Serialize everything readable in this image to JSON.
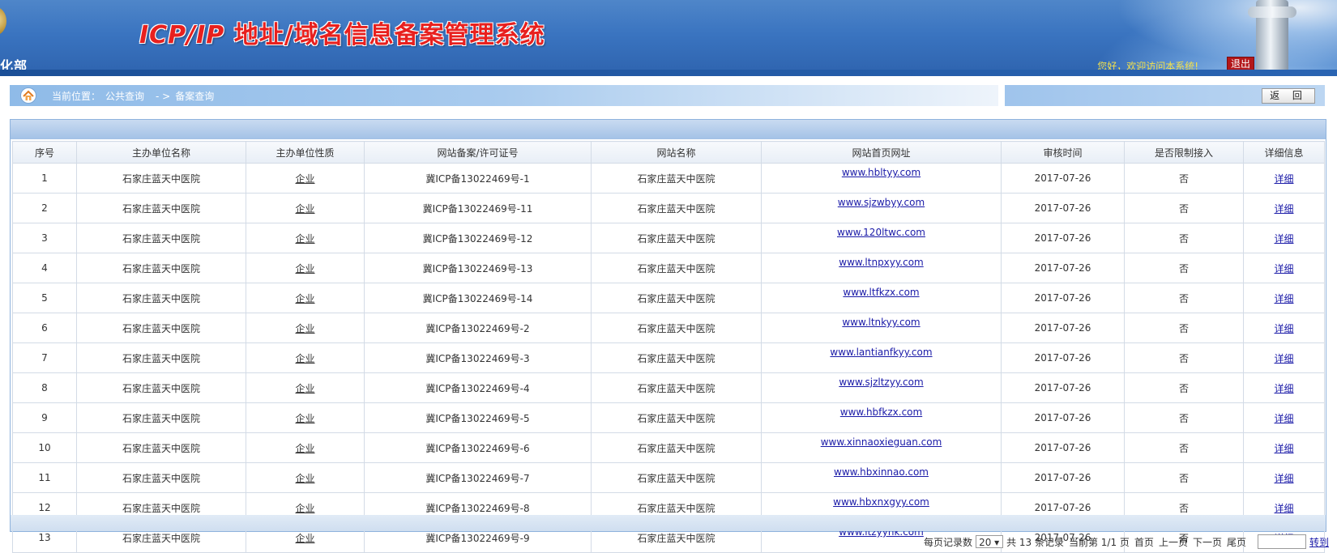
{
  "header": {
    "title_latin": "ICP/IP ",
    "title_cn": "地址/域名信息备案管理系统",
    "dept": "化部",
    "welcome": "您好，欢迎访问本系统!",
    "logout": "退出"
  },
  "breadcrumb": {
    "prefix": "当前位置：",
    "level1": "公共查询",
    "separator": "- >",
    "level2": "备案查询"
  },
  "return_button": "返 回",
  "table": {
    "headers": [
      "序号",
      "主办单位名称",
      "主办单位性质",
      "网站备案/许可证号",
      "网站名称",
      "网站首页网址",
      "审核时间",
      "是否限制接入",
      "详细信息"
    ],
    "rows": [
      {
        "no": "1",
        "org": "石家庄蓝天中医院",
        "type": "企业",
        "license": "冀ICP备13022469号-1",
        "site": "石家庄蓝天中医院",
        "url": "www.hbltyy.com",
        "date": "2017-07-26",
        "restricted": "否",
        "detail": "详细"
      },
      {
        "no": "2",
        "org": "石家庄蓝天中医院",
        "type": "企业",
        "license": "冀ICP备13022469号-11",
        "site": "石家庄蓝天中医院",
        "url": "www.sjzwbyy.com",
        "date": "2017-07-26",
        "restricted": "否",
        "detail": "详细"
      },
      {
        "no": "3",
        "org": "石家庄蓝天中医院",
        "type": "企业",
        "license": "冀ICP备13022469号-12",
        "site": "石家庄蓝天中医院",
        "url": "www.120ltwc.com",
        "date": "2017-07-26",
        "restricted": "否",
        "detail": "详细"
      },
      {
        "no": "4",
        "org": "石家庄蓝天中医院",
        "type": "企业",
        "license": "冀ICP备13022469号-13",
        "site": "石家庄蓝天中医院",
        "url": "www.ltnpxyy.com",
        "date": "2017-07-26",
        "restricted": "否",
        "detail": "详细"
      },
      {
        "no": "5",
        "org": "石家庄蓝天中医院",
        "type": "企业",
        "license": "冀ICP备13022469号-14",
        "site": "石家庄蓝天中医院",
        "url": "www.ltfkzx.com",
        "date": "2017-07-26",
        "restricted": "否",
        "detail": "详细"
      },
      {
        "no": "6",
        "org": "石家庄蓝天中医院",
        "type": "企业",
        "license": "冀ICP备13022469号-2",
        "site": "石家庄蓝天中医院",
        "url": "www.ltnkyy.com",
        "date": "2017-07-26",
        "restricted": "否",
        "detail": "详细"
      },
      {
        "no": "7",
        "org": "石家庄蓝天中医院",
        "type": "企业",
        "license": "冀ICP备13022469号-3",
        "site": "石家庄蓝天中医院",
        "url": "www.lantianfkyy.com",
        "date": "2017-07-26",
        "restricted": "否",
        "detail": "详细"
      },
      {
        "no": "8",
        "org": "石家庄蓝天中医院",
        "type": "企业",
        "license": "冀ICP备13022469号-4",
        "site": "石家庄蓝天中医院",
        "url": "www.sjzltzyy.com",
        "date": "2017-07-26",
        "restricted": "否",
        "detail": "详细"
      },
      {
        "no": "9",
        "org": "石家庄蓝天中医院",
        "type": "企业",
        "license": "冀ICP备13022469号-5",
        "site": "石家庄蓝天中医院",
        "url": "www.hbfkzx.com",
        "date": "2017-07-26",
        "restricted": "否",
        "detail": "详细"
      },
      {
        "no": "10",
        "org": "石家庄蓝天中医院",
        "type": "企业",
        "license": "冀ICP备13022469号-6",
        "site": "石家庄蓝天中医院",
        "url": "www.xinnaoxieguan.com",
        "date": "2017-07-26",
        "restricted": "否",
        "detail": "详细"
      },
      {
        "no": "11",
        "org": "石家庄蓝天中医院",
        "type": "企业",
        "license": "冀ICP备13022469号-7",
        "site": "石家庄蓝天中医院",
        "url": "www.hbxinnao.com",
        "date": "2017-07-26",
        "restricted": "否",
        "detail": "详细"
      },
      {
        "no": "12",
        "org": "石家庄蓝天中医院",
        "type": "企业",
        "license": "冀ICP备13022469号-8",
        "site": "石家庄蓝天中医院",
        "url": "www.hbxnxgyy.com",
        "date": "2017-07-26",
        "restricted": "否",
        "detail": "详细"
      },
      {
        "no": "13",
        "org": "石家庄蓝天中医院",
        "type": "企业",
        "license": "冀ICP备13022469号-9",
        "site": "石家庄蓝天中医院",
        "url": "www.ltzyynk.com",
        "date": "2017-07-26",
        "restricted": "否",
        "detail": "详细"
      }
    ]
  },
  "pager": {
    "per_page_label": "每页记录数",
    "per_page_value": "20",
    "total": "共 13 条记录",
    "current": "当前第 1/1 页",
    "first": "首页",
    "prev": "上一页",
    "next": "下一页",
    "last": "尾页",
    "goto": "转到"
  }
}
